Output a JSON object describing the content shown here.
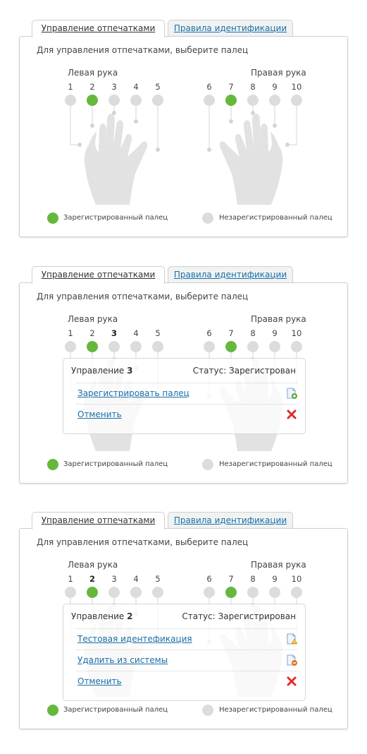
{
  "colors": {
    "registered": "#66b83d",
    "unregistered": "#dcdcdc",
    "link": "#1a6fa8"
  },
  "panels": [
    {
      "tabs": {
        "active": "Управление отпечатками",
        "inactive": "Правила идентификации"
      },
      "instruction": "Для управления отпечатками, выберите палец",
      "left_hand_label": "Левая рука",
      "right_hand_label": "Правая рука",
      "fingers": [
        {
          "num": "1",
          "registered": false
        },
        {
          "num": "2",
          "registered": true
        },
        {
          "num": "3",
          "registered": false
        },
        {
          "num": "4",
          "registered": false
        },
        {
          "num": "5",
          "registered": false
        },
        {
          "num": "6",
          "registered": false
        },
        {
          "num": "7",
          "registered": true
        },
        {
          "num": "8",
          "registered": false
        },
        {
          "num": "9",
          "registered": false
        },
        {
          "num": "10",
          "registered": false
        }
      ],
      "selected_finger": null,
      "legend": {
        "registered": "Зарегистрированный палец",
        "unregistered": "Незарегистрированный палец"
      }
    },
    {
      "tabs": {
        "active": "Управление отпечатками",
        "inactive": "Правила идентификации"
      },
      "instruction": "Для управления отпечатками, выберите палец",
      "left_hand_label": "Левая рука",
      "right_hand_label": "Правая рука",
      "fingers": [
        {
          "num": "1",
          "registered": false
        },
        {
          "num": "2",
          "registered": true
        },
        {
          "num": "3",
          "registered": false
        },
        {
          "num": "4",
          "registered": false
        },
        {
          "num": "5",
          "registered": false
        },
        {
          "num": "6",
          "registered": false
        },
        {
          "num": "7",
          "registered": true
        },
        {
          "num": "8",
          "registered": false
        },
        {
          "num": "9",
          "registered": false
        },
        {
          "num": "10",
          "registered": false
        }
      ],
      "selected_finger": "3",
      "popup": {
        "title_prefix": "Управление",
        "finger": "3",
        "status": "Статус: Зарегистрован",
        "actions": [
          {
            "label": "Зарегистрировать палец",
            "icon": "document-add-icon"
          },
          {
            "label": "Отменить",
            "icon": "red-cross-icon"
          }
        ]
      },
      "legend": {
        "registered": "Зарегистрированный палец",
        "unregistered": "Незарегистрированный палец"
      }
    },
    {
      "tabs": {
        "active": "Управление отпечатками",
        "inactive": "Правила идентификации"
      },
      "instruction": "Для управления отпечатками, выберите палец",
      "left_hand_label": "Левая рука",
      "right_hand_label": "Правая рука",
      "fingers": [
        {
          "num": "1",
          "registered": false
        },
        {
          "num": "2",
          "registered": true
        },
        {
          "num": "3",
          "registered": false
        },
        {
          "num": "4",
          "registered": false
        },
        {
          "num": "5",
          "registered": false
        },
        {
          "num": "6",
          "registered": false
        },
        {
          "num": "7",
          "registered": true
        },
        {
          "num": "8",
          "registered": false
        },
        {
          "num": "9",
          "registered": false
        },
        {
          "num": "10",
          "registered": false
        }
      ],
      "selected_finger": "2",
      "popup": {
        "title_prefix": "Управление",
        "finger": "2",
        "status": "Статус: Зарегистрирован",
        "actions": [
          {
            "label": "Тестовая идентефикация",
            "icon": "document-warning-icon"
          },
          {
            "label": "Удалить из системы",
            "icon": "document-remove-icon"
          },
          {
            "label": "Отменить",
            "icon": "red-cross-icon"
          }
        ]
      },
      "legend": {
        "registered": "Зарегистрированный палец",
        "unregistered": "Незарегистрированный палец"
      }
    }
  ]
}
